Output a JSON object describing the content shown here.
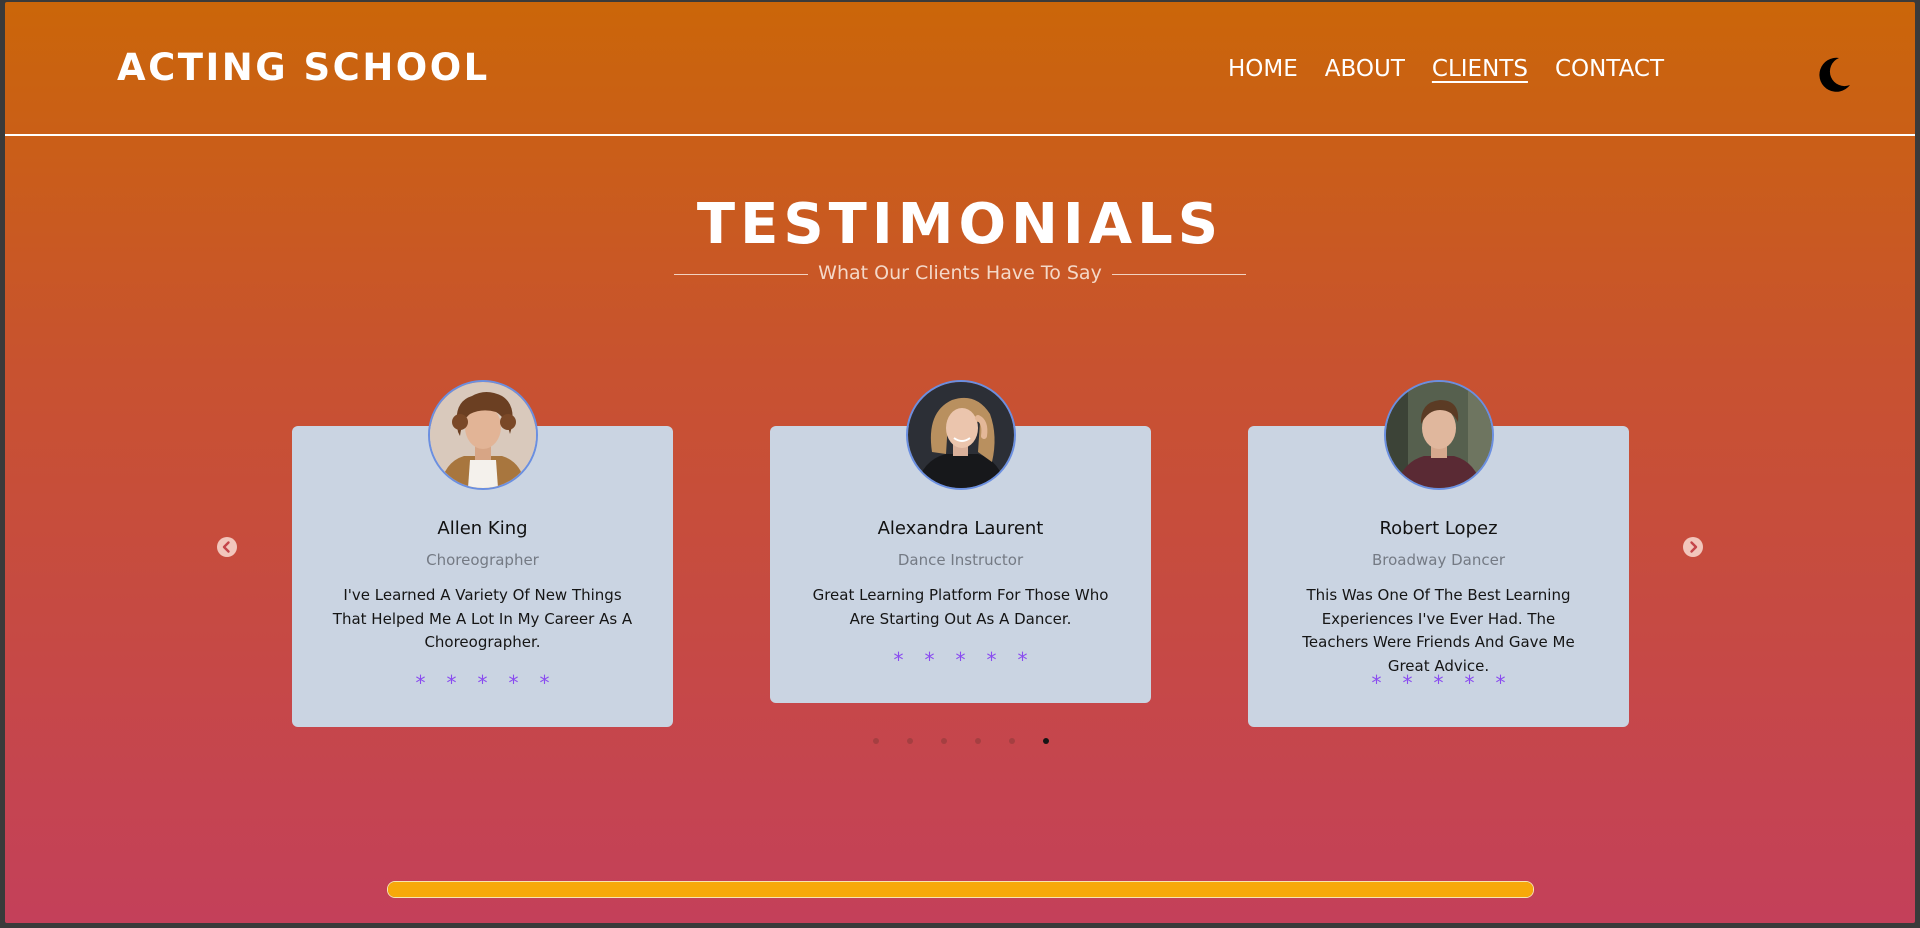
{
  "header": {
    "brand": "ACTING SCHOOL",
    "nav": [
      "HOME",
      "ABOUT",
      "CLIENTS",
      "CONTACT"
    ],
    "active_nav": "CLIENTS",
    "theme_toggle_icon": "moon-icon"
  },
  "testimonials": {
    "title": "TESTIMONIALS",
    "subtitle": "What Our Clients Have To Say",
    "cards": [
      {
        "name": "Allen King",
        "role": "Choreographer",
        "quote": "I've Learned A Variety Of New Things That Helped Me A Lot In My Career As A Choreographer.",
        "stars": [
          "*",
          "*",
          "*",
          "*",
          "*"
        ]
      },
      {
        "name": "Alexandra Laurent",
        "role": "Dance Instructor",
        "quote": "Great Learning Platform For Those Who Are Starting Out As A Dancer.",
        "stars": [
          "*",
          "*",
          "*",
          "*",
          "*"
        ]
      },
      {
        "name": "Robert Lopez",
        "role": "Broadway Dancer",
        "quote": "This Was One Of The Best Learning Experiences I've Ever Had. The Teachers Were Friends And Gave Me Great Advice.",
        "stars": [
          "*",
          "*",
          "*",
          "*",
          "*"
        ]
      }
    ],
    "prev_icon": "chevron-left-icon",
    "next_icon": "chevron-right-icon",
    "pagination_count": 6,
    "active_page": 6
  },
  "progress": {
    "fraction": 1.0
  },
  "colors": {
    "gradient_top": "#cb6609",
    "gradient_bottom": "#c4405a",
    "card_bg": "#cad4e2",
    "star": "#8a4cf0",
    "progress": "#f7a90a"
  }
}
